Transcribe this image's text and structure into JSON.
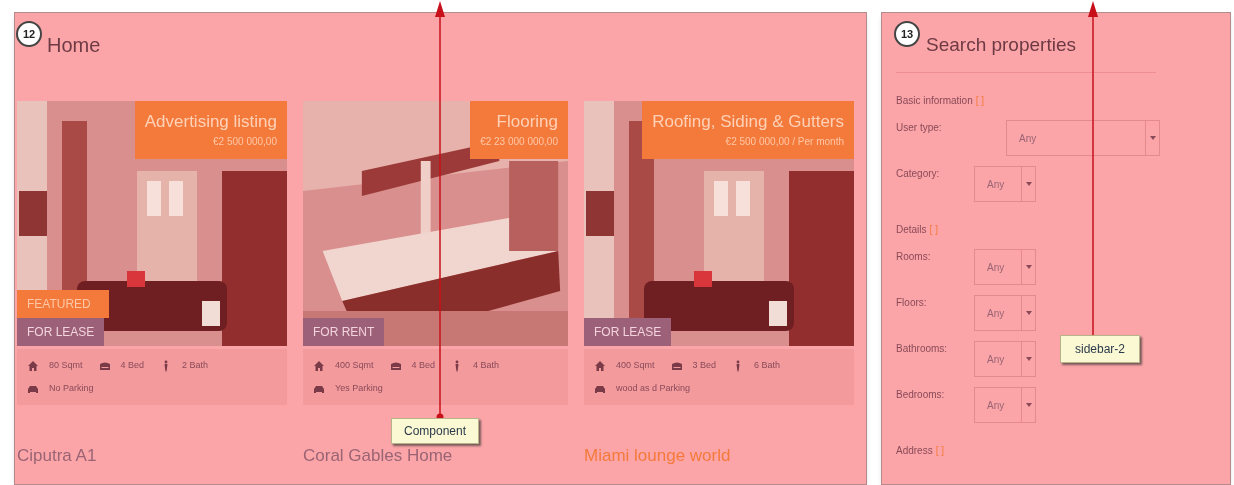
{
  "main": {
    "badge_number": "12",
    "title": "Home",
    "callout": "Component",
    "listings": [
      {
        "headline": "Advertising listing",
        "price": "€2 500 000,00",
        "featured": true,
        "featured_label": "FEATURED",
        "status": "FOR LEASE",
        "features": [
          {
            "kind": "area",
            "text": "80 Sqmt"
          },
          {
            "kind": "bed",
            "text": "4 Bed"
          },
          {
            "kind": "bath",
            "text": "2 Bath"
          },
          {
            "kind": "parking",
            "text": "No Parking"
          }
        ],
        "name": "Ciputra A1",
        "highlighted": false
      },
      {
        "headline": "Flooring",
        "price": "€2 23 000 000,00",
        "featured": false,
        "status": "FOR RENT",
        "features": [
          {
            "kind": "area",
            "text": "400 Sqmt"
          },
          {
            "kind": "bed",
            "text": "4 Bed"
          },
          {
            "kind": "bath",
            "text": "4 Bath"
          },
          {
            "kind": "parking",
            "text": "Yes Parking"
          }
        ],
        "name": "Coral Gables Home",
        "highlighted": false
      },
      {
        "headline": "Roofing, Siding & Gutters",
        "price": "€2 500 000,00 / Per month",
        "featured": false,
        "status": "FOR LEASE",
        "features": [
          {
            "kind": "area",
            "text": "400 Sqmt"
          },
          {
            "kind": "bed",
            "text": "3 Bed"
          },
          {
            "kind": "bath",
            "text": "6 Bath"
          },
          {
            "kind": "parking",
            "text": "wood as d Parking"
          }
        ],
        "name": "Miami lounge world",
        "highlighted": true
      }
    ]
  },
  "sidebar": {
    "badge_number": "13",
    "title": "Search properties",
    "callout": "sidebar-2",
    "sections": [
      {
        "title": "Basic information",
        "toggle": "[ ]",
        "fields": [
          {
            "label": "User type:",
            "value": "Any",
            "wide": true
          },
          {
            "label": "Category:",
            "value": "Any",
            "wide": false
          }
        ]
      },
      {
        "title": "Details",
        "toggle": "[ ]",
        "fields": [
          {
            "label": "Rooms:",
            "value": "Any",
            "wide": false
          },
          {
            "label": "Floors:",
            "value": "Any",
            "wide": false
          },
          {
            "label": "Bathrooms:",
            "value": "Any",
            "wide": false
          },
          {
            "label": "Bedrooms:",
            "value": "Any",
            "wide": false
          }
        ]
      },
      {
        "title": "Address",
        "toggle": "[ ]"
      }
    ]
  }
}
